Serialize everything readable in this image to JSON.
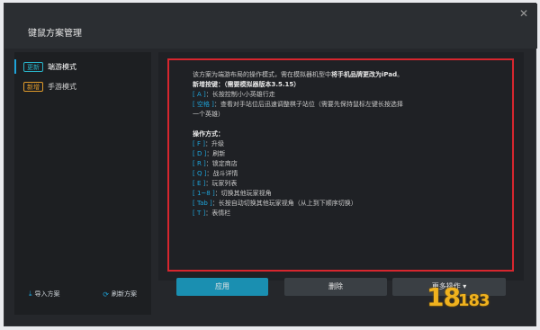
{
  "window": {
    "title": "键鼠方案管理",
    "close_glyph": "✕"
  },
  "sidebar": {
    "items": [
      {
        "badge": "更新",
        "label": "端游模式",
        "active": true
      },
      {
        "badge": "新增",
        "label": "手游模式",
        "active": false
      }
    ],
    "footer": {
      "import_label": "导入方案",
      "refresh_label": "刷新方案"
    }
  },
  "content": {
    "lines": [
      {
        "segments": [
          {
            "text": "该方案为端游布局的操作模式，需在模拟器机型中"
          },
          {
            "text": "将手机品牌更改为iPad",
            "style": "bold"
          },
          {
            "text": "。"
          }
        ]
      },
      {
        "segments": [
          {
            "text": "新增按键：（需要模拟器版本3.5.15）",
            "style": "bold"
          }
        ]
      },
      {
        "segments": [
          {
            "text": "[ A ]",
            "style": "hl"
          },
          {
            "text": "：长按控制小小英雄行走"
          }
        ]
      },
      {
        "segments": [
          {
            "text": "[ 空格 ]",
            "style": "hl"
          },
          {
            "text": "：查看对手站位后迅速调整棋子站位（需要先保持鼠标左键长按选择"
          }
        ]
      },
      {
        "segments": [
          {
            "text": "一个英雄）"
          }
        ]
      },
      {
        "segments": [
          {
            "text": ""
          }
        ]
      },
      {
        "segments": [
          {
            "text": "操作方式：",
            "style": "bold"
          }
        ]
      },
      {
        "segments": [
          {
            "text": "[ F ]",
            "style": "hl"
          },
          {
            "text": "：升级"
          }
        ]
      },
      {
        "segments": [
          {
            "text": "[ D ]",
            "style": "hl"
          },
          {
            "text": "：刷新"
          }
        ]
      },
      {
        "segments": [
          {
            "text": "[ R ]",
            "style": "hl"
          },
          {
            "text": "：锁定商店"
          }
        ]
      },
      {
        "segments": [
          {
            "text": "[ Q ]",
            "style": "hl"
          },
          {
            "text": "：战斗详情"
          }
        ]
      },
      {
        "segments": [
          {
            "text": "[ E ]",
            "style": "hl"
          },
          {
            "text": "：玩家列表"
          }
        ]
      },
      {
        "segments": [
          {
            "text": "[ 1~8 ]",
            "style": "hl"
          },
          {
            "text": "：切换其他玩家视角"
          }
        ]
      },
      {
        "segments": [
          {
            "text": "[ Tab ]",
            "style": "hl"
          },
          {
            "text": "：长按自动切换其他玩家视角（从上到下顺序切换）"
          }
        ]
      },
      {
        "segments": [
          {
            "text": "[ T ]",
            "style": "hl"
          },
          {
            "text": "：表情栏"
          }
        ]
      }
    ]
  },
  "buttons": {
    "apply_label": "应用",
    "delete_label": "删除",
    "more_label": "更多操作 ▾"
  },
  "watermark": {
    "main": "18",
    "small": "183"
  },
  "colors": {
    "accent": "#1ea3d9",
    "highlight_border": "#d7262e",
    "badge_updated": "#28b2c8",
    "badge_new": "#e09a2a"
  }
}
